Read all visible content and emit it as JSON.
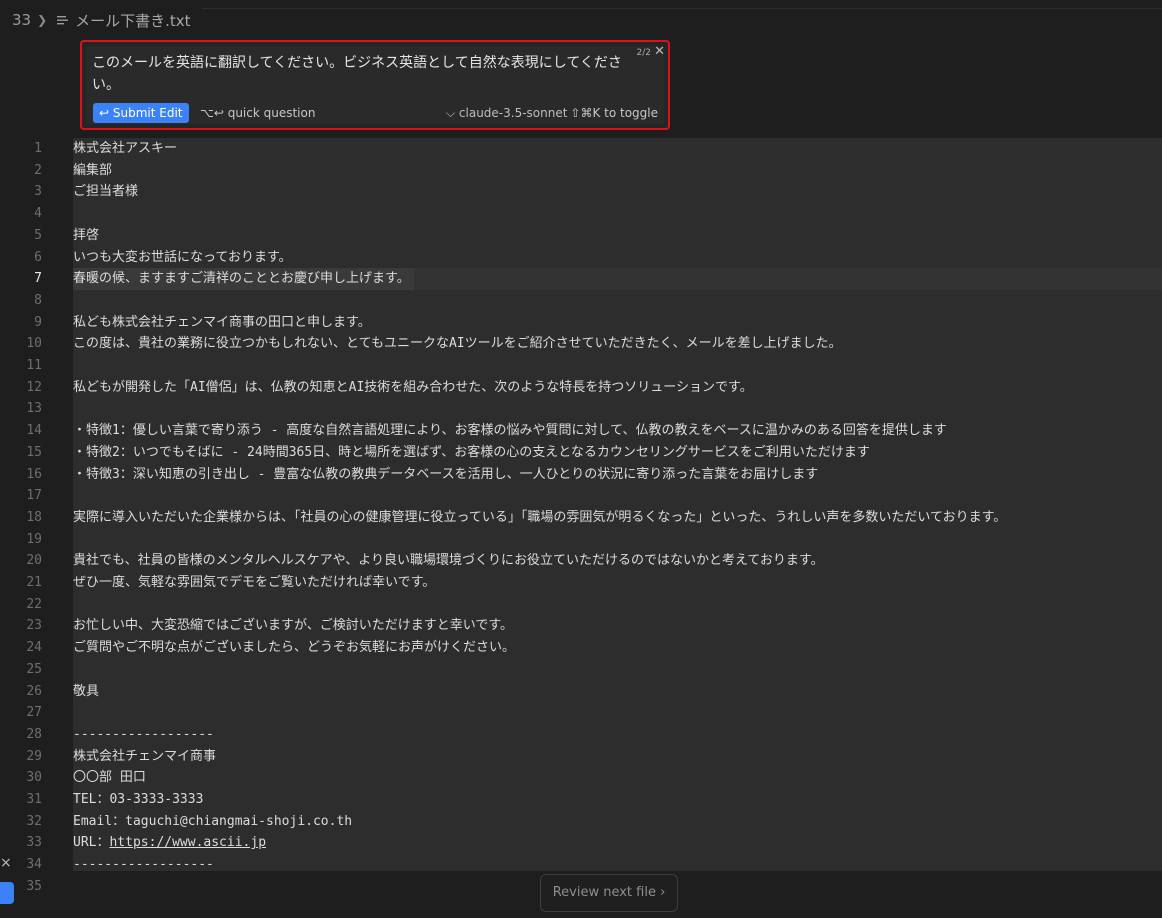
{
  "breadcrumb": {
    "line": "33",
    "file": "メール下書き.txt"
  },
  "prompt": {
    "text": "このメールを英語に翻訳してください。ビジネス英語として自然な表現にしてください。",
    "counter": "2/2",
    "submit": "↩ Submit Edit",
    "quick": "⌥↩ quick question",
    "model": "⌵ claude-3.5-sonnet",
    "toggle": "⇧⌘K to toggle"
  },
  "editor": {
    "active_line": 7,
    "lines": [
      "株式会社アスキー",
      "編集部",
      "ご担当者様",
      "",
      "拝啓",
      "いつも大変お世話になっております。",
      "春暖の候、ますますご清祥のこととお慶び申し上げます。",
      "",
      "私ども株式会社チェンマイ商事の田口と申します。",
      "この度は、貴社の業務に役立つかもしれない、とてもユニークなAIツールをご紹介させていただきたく、メールを差し上げました。",
      "",
      "私どもが開発した「AI僧侶」は、仏教の知恵とAI技術を組み合わせた、次のような特長を持つソリューションです。",
      "",
      "・特徴1：優しい言葉で寄り添う - 高度な自然言語処理により、お客様の悩みや質問に対して、仏教の教えをベースに温かみのある回答を提供します",
      "・特徴2：いつでもそばに - 24時間365日、時と場所を選ばず、お客様の心の支えとなるカウンセリングサービスをご利用いただけます",
      "・特徴3：深い知恵の引き出し - 豊富な仏教の教典データベースを活用し、一人ひとりの状況に寄り添った言葉をお届けします",
      "",
      "実際に導入いただいた企業様からは、「社員の心の健康管理に役立っている」「職場の雰囲気が明るくなった」といった、うれしい声を多数いただいております。",
      "",
      "貴社でも、社員の皆様のメンタルヘルスケアや、より良い職場環境づくりにお役立ていただけるのではないかと考えております。",
      "ぜひ一度、気軽な雰囲気でデモをご覧いただければ幸いです。",
      "",
      "お忙しい中、大変恐縮ではございますが、ご検討いただけますと幸いです。",
      "ご質問やご不明な点がございましたら、どうぞお気軽にお声がけください。",
      "",
      "敬具",
      "",
      "------------------",
      "株式会社チェンマイ商事",
      "〇〇部 田口",
      "TEL：03-3333-3333",
      "Email：taguchi@chiangmai-shoji.co.th",
      "URL：https://www.ascii.jp",
      "------------------",
      ""
    ]
  },
  "review_button": "Review next file ›",
  "side_close": "×"
}
